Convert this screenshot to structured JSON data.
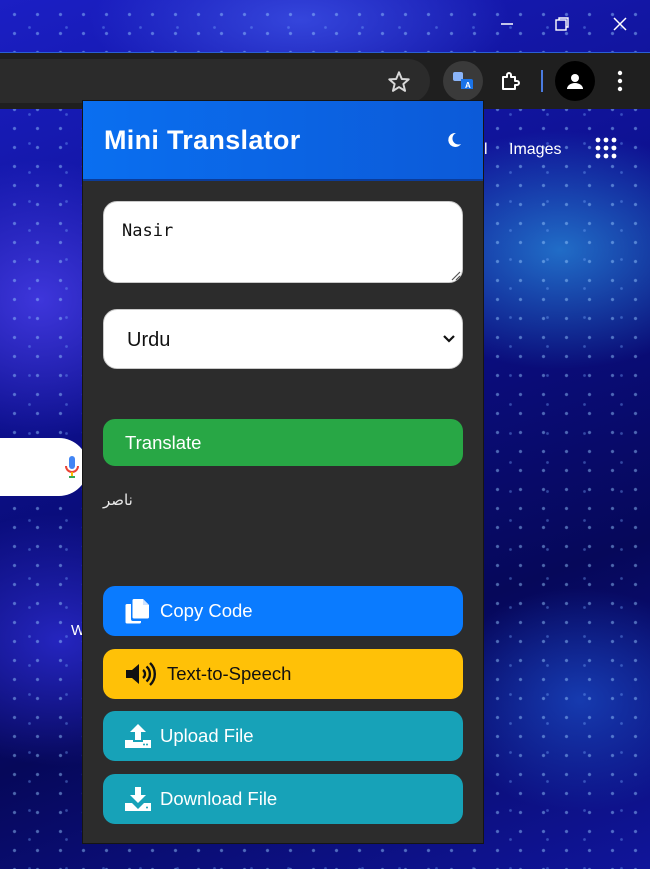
{
  "browser": {
    "window_controls": [
      "minimize",
      "maximize",
      "close"
    ]
  },
  "background_page": {
    "link_fragment": "l",
    "images_link": "Images",
    "partial_text": "W"
  },
  "popup": {
    "title": "Mini Translator",
    "input_value": "Nasir",
    "language_selected": "Urdu",
    "translate_label": "Translate",
    "result": "ناصر",
    "buttons": {
      "copy": "Copy Code",
      "tts": "Text-to-Speech",
      "upload": "Upload File",
      "download": "Download File"
    }
  },
  "colors": {
    "header": "#0a6ff0",
    "translate": "#28a745",
    "copy": "#0a7bff",
    "tts": "#ffc107",
    "file_buttons": "#17a2b8",
    "popup_bg": "#2c2c2c"
  }
}
